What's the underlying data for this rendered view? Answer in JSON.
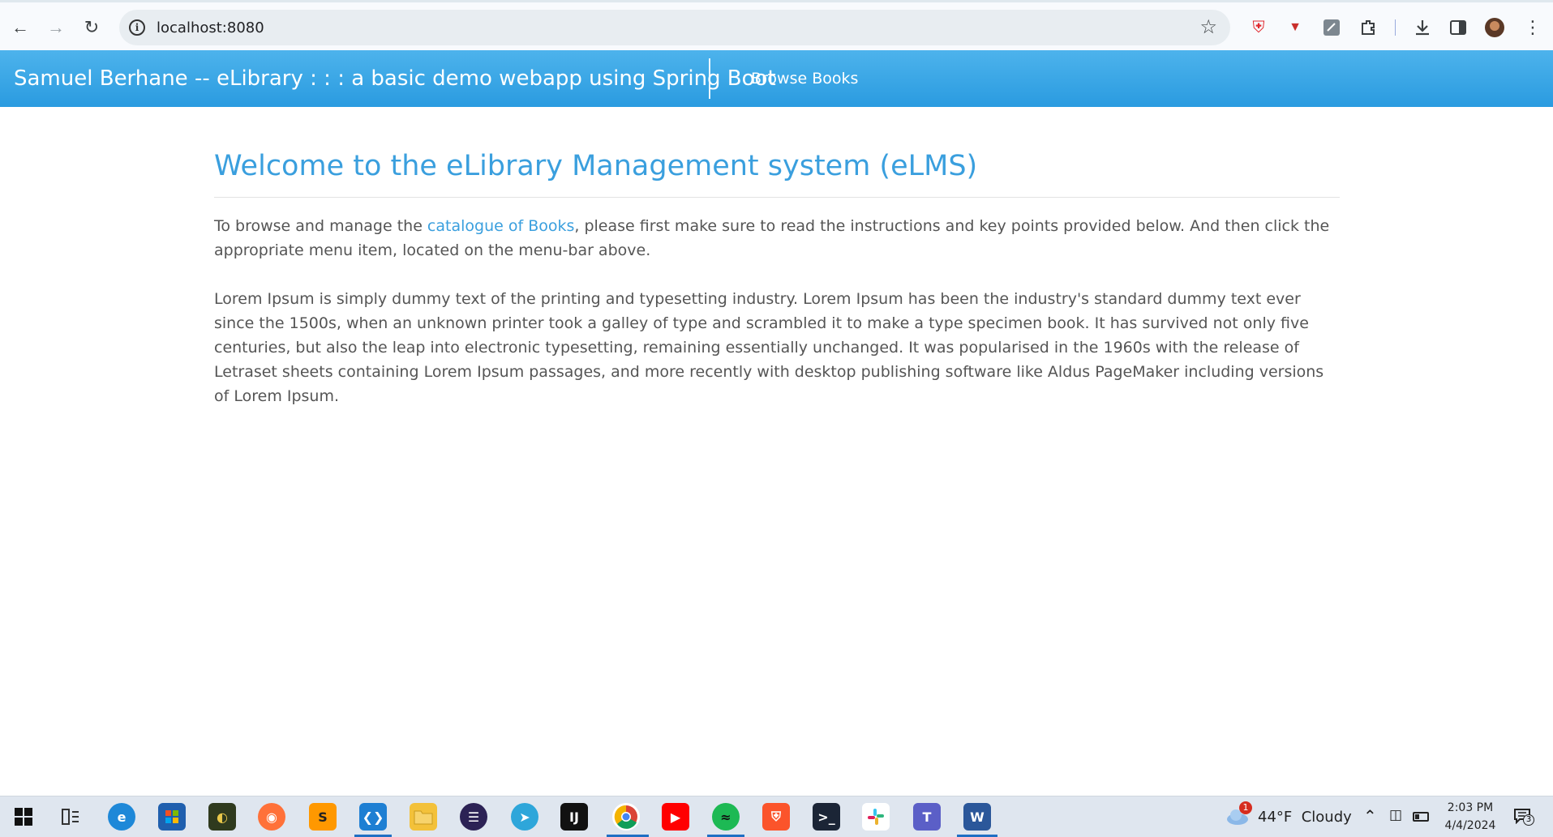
{
  "browser": {
    "url": "localhost:8080",
    "back_icon": "arrow-left-icon",
    "forward_icon": "arrow-right-icon",
    "reload_icon": "reload-icon"
  },
  "navbar": {
    "brand": "Samuel Berhane -- eLibrary : : : a basic demo webapp using Spring Boot",
    "browse_books": "Browse Books",
    "color": "#2a9be0"
  },
  "main": {
    "title": "Welcome to the eLibrary Management system (eLMS)",
    "intro_before": "To browse and manage the ",
    "intro_link": "catalogue of Books",
    "intro_after": ", please first make sure to read the instructions and key points provided below. And then click the appropriate menu item, located on the menu-bar above.",
    "lorem": "Lorem Ipsum is simply dummy text of the printing and typesetting industry. Lorem Ipsum has been the industry's standard dummy text ever since the 1500s, when an unknown printer took a galley of type and scrambled it to make a type specimen book. It has survived not only five centuries, but also the leap into electronic typesetting, remaining essentially unchanged. It was popularised in the 1960s with the release of Letraset sheets containing Lorem Ipsum passages, and more recently with desktop publishing software like Aldus PageMaker including versions of Lorem Ipsum."
  },
  "taskbar": {
    "weather": "44°F  Cloudy",
    "weather_badge": "1",
    "time": "2:03 PM",
    "date": "4/4/2024",
    "notifications": "3"
  }
}
